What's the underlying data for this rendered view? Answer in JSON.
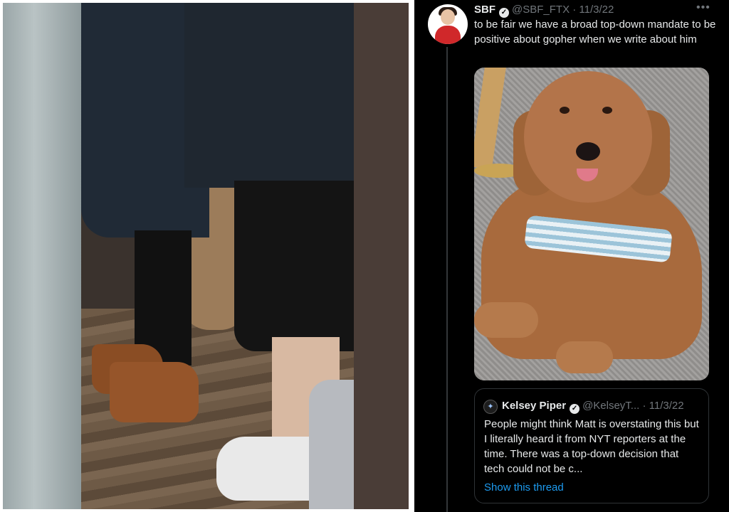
{
  "tweet": {
    "display_name": "SBF",
    "handle": "@SBF_FTX",
    "separator": "·",
    "date": "11/3/22",
    "more_icon": "more-horizontal-icon",
    "verified_icon": "verified-badge-icon",
    "text": "to be fair we have a broad top-down mandate to be positive about gopher when we write about him"
  },
  "quoted_tweet": {
    "display_name": "Kelsey Piper",
    "handle": "@KelseyT...",
    "separator": "·",
    "date": "11/3/22",
    "text": "People might think Matt is overstating this but I literally heard it from NYT reporters at the time. There was a top-down decision that tech could not be c...",
    "show_thread_label": "Show this thread"
  },
  "colors": {
    "tweet_background": "#000000",
    "text_primary": "#e7e9ea",
    "text_secondary": "#71767b",
    "link": "#1d9bf0",
    "border": "#2f3336"
  }
}
